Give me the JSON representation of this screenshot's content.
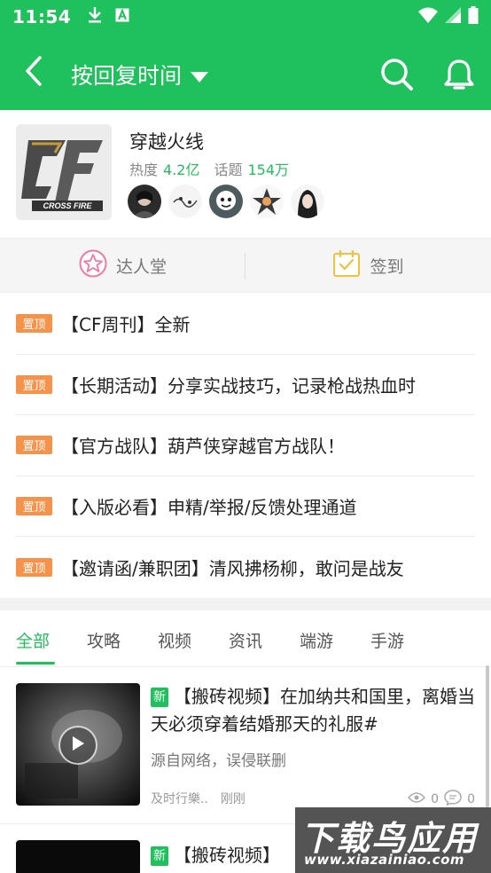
{
  "status_bar": {
    "time": "11:54",
    "icons": [
      "download-icon",
      "a-icon",
      "wifi-icon",
      "signal-icon",
      "battery-icon"
    ]
  },
  "app_bar": {
    "sort_label": "按回复时间",
    "icons": [
      "back-arrow-icon",
      "dropdown-caret-icon",
      "search-icon",
      "bell-icon"
    ],
    "color": "#1fc15d"
  },
  "forum": {
    "name": "穿越火线",
    "heat_label": "热度",
    "heat_value": "4.2亿",
    "topics_label": "话题",
    "topics_value": "154万",
    "logo_text": "CROSS FIRE",
    "avatars": [
      "avatar-1",
      "avatar-2",
      "avatar-3",
      "avatar-4",
      "avatar-5"
    ]
  },
  "actions": {
    "experts_label": "达人堂",
    "checkin_label": "签到"
  },
  "pinned": {
    "badge": "置顶",
    "items": [
      "【CF周刊】全新",
      "【长期活动】分享实战技巧，记录枪战热血时",
      "【官方战队】葫芦侠穿越官方战队！",
      "【入版必看】申精/举报/反馈处理通道",
      "【邀请函/兼职团】清风拂杨柳，敢问是战友"
    ]
  },
  "tabs": [
    "全部",
    "攻略",
    "视频",
    "资讯",
    "端游",
    "手游"
  ],
  "posts": [
    {
      "badge": "新",
      "title": "【搬砖视频】在加纳共和国里，离婚当天必须穿着结婚那天的礼服#",
      "subtitle": "源自网络，误侵联删",
      "author": "及时行樂..",
      "time": "刚刚",
      "likes": "0",
      "comments": "0"
    },
    {
      "badge": "新",
      "title": "【搬砖视频】"
    }
  ],
  "watermark": {
    "main": "下载鸟应用",
    "sub": "www.xiazainiao.com"
  }
}
